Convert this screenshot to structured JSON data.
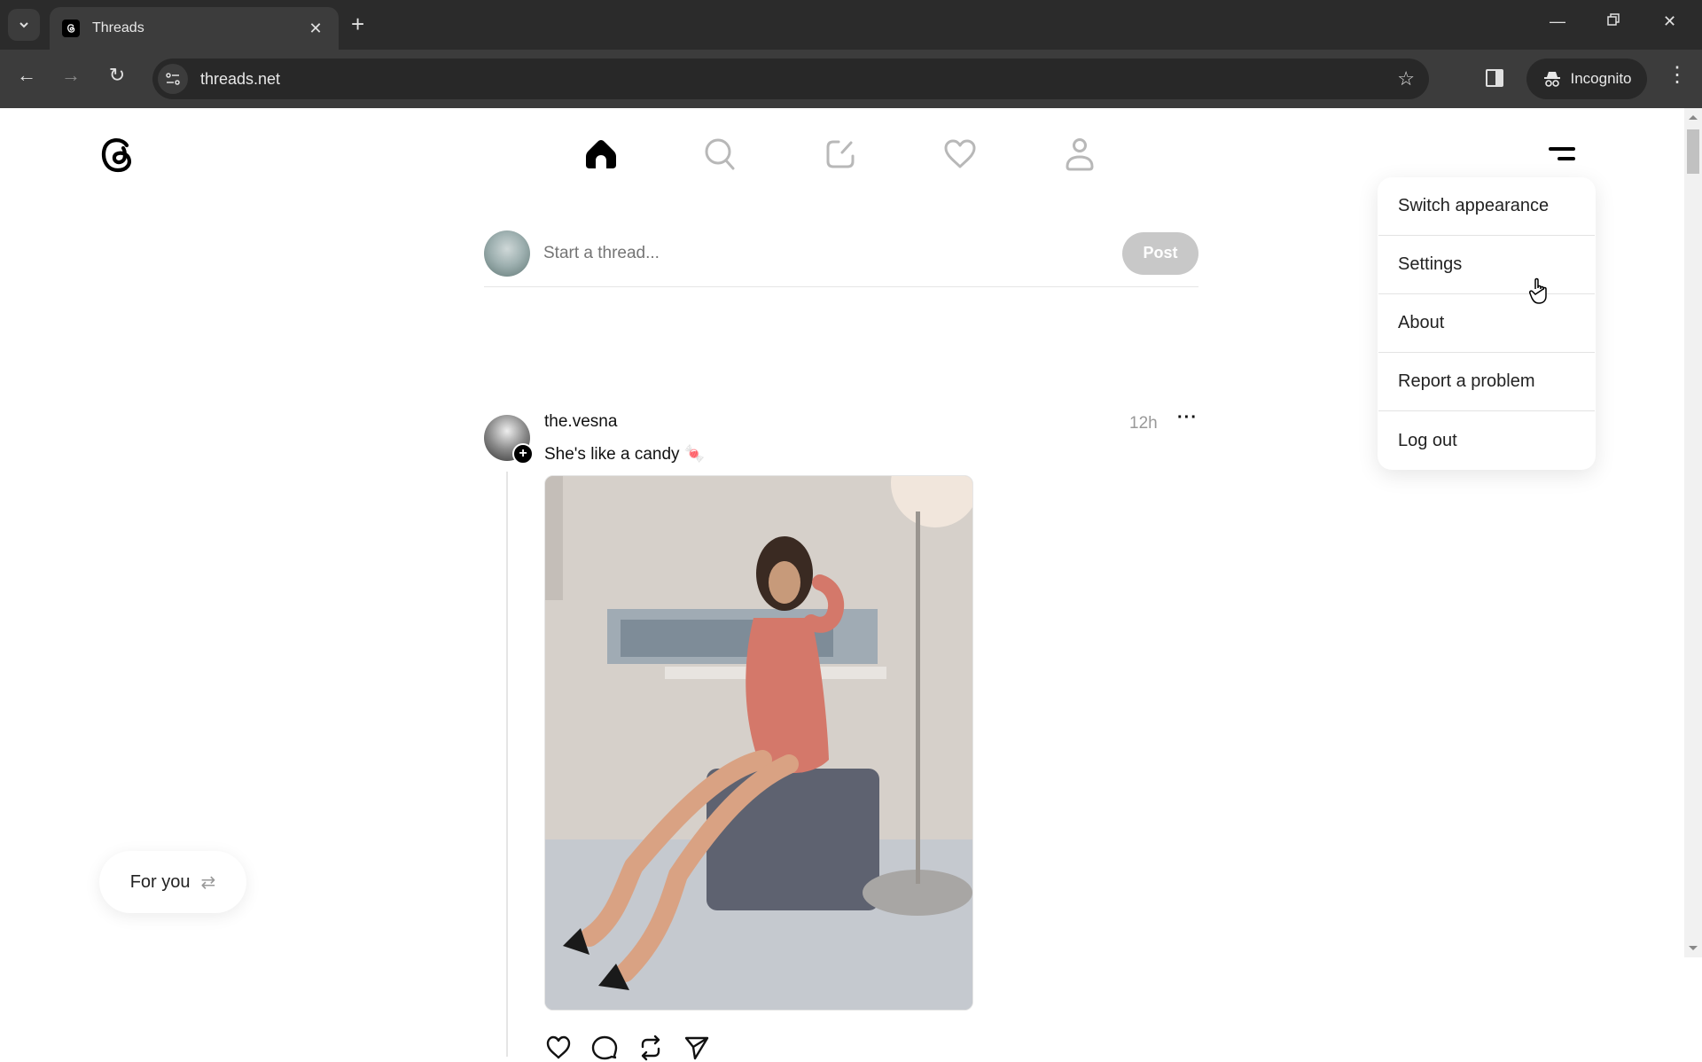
{
  "browser": {
    "tab_title": "Threads",
    "url": "threads.net",
    "incognito_label": "Incognito"
  },
  "nav": {
    "items": [
      {
        "name": "home",
        "active": true
      },
      {
        "name": "search",
        "active": false
      },
      {
        "name": "create",
        "active": false
      },
      {
        "name": "activity",
        "active": false
      },
      {
        "name": "profile",
        "active": false
      }
    ]
  },
  "composer": {
    "placeholder": "Start a thread...",
    "post_label": "Post"
  },
  "post": {
    "username": "the.vesna",
    "text": "She's like a candy 🍬",
    "timestamp": "12h",
    "more_label": "···",
    "image_alt": "Woman in pink dress sitting on a grey ottoman"
  },
  "menu": {
    "items": [
      "Switch appearance",
      "Settings",
      "About",
      "Report a problem",
      "Log out"
    ]
  },
  "feed_toggle": {
    "label": "For you",
    "icon": "⇄"
  },
  "colors": {
    "active_icon": "#000000",
    "inactive_icon": "#b8b8b8",
    "post_button_disabled": "#c8c8c8"
  }
}
